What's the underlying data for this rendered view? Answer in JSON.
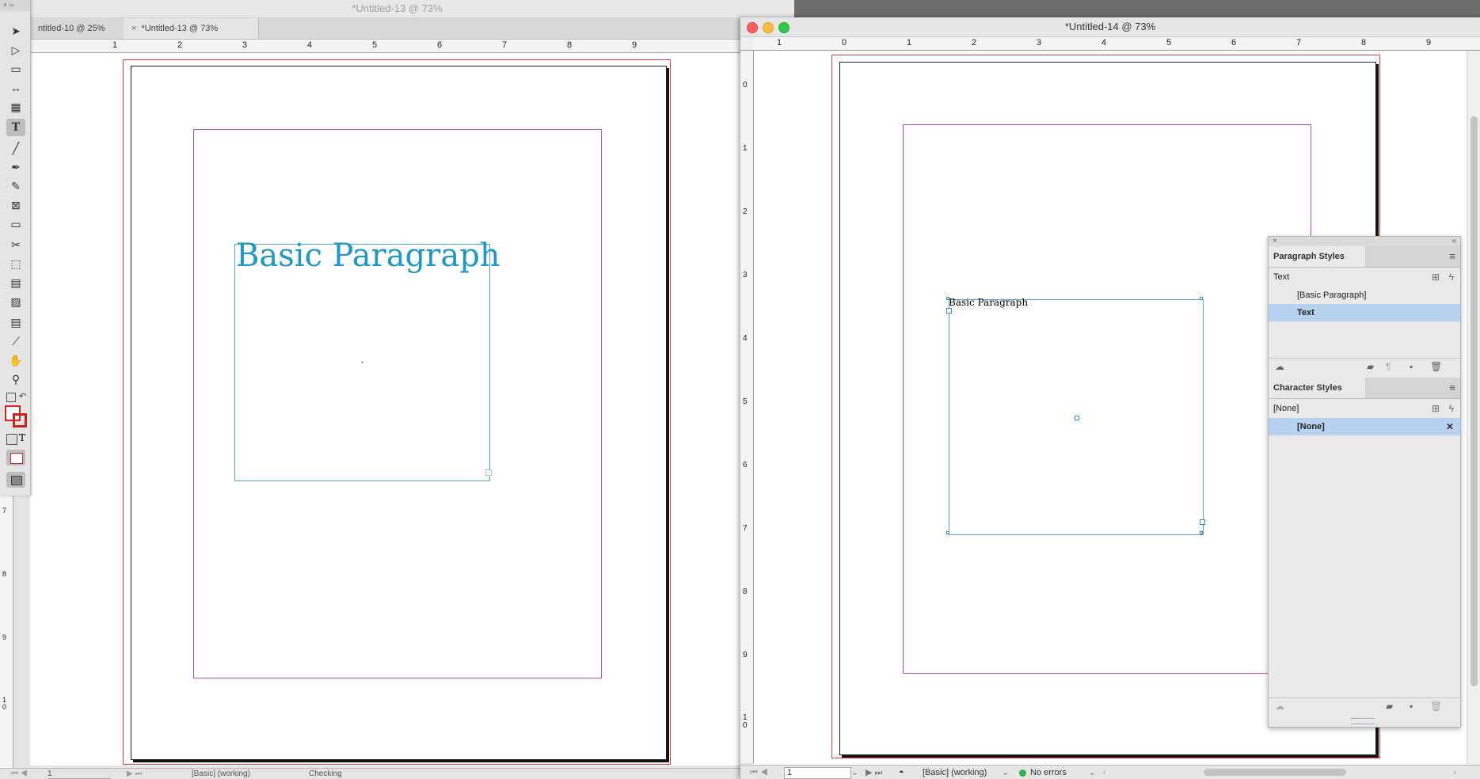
{
  "left_window": {
    "title": "*Untitled-13 @ 73%",
    "tabs": [
      "ntitled-10 @ 25%",
      "*Untitled-13 @ 73%"
    ],
    "tab_close_glyph": "×",
    "ruler_labels": [
      "1",
      "2",
      "3",
      "4",
      "5",
      "6",
      "7",
      "8",
      "9"
    ],
    "vruler_labels": [
      "7",
      "8",
      "9",
      "1\n0"
    ],
    "frame_text": "Basic Paragraph",
    "frame_text_color": "#1e98c8",
    "status": {
      "page": "1",
      "profile": "[Basic] (working)",
      "preflight": "Checking"
    }
  },
  "toolbar": {
    "collapse_glyphs": "×  ››",
    "tools": [
      {
        "name": "selection-tool",
        "glyph": "➤"
      },
      {
        "name": "direct-selection-tool",
        "glyph": "▷"
      },
      {
        "name": "page-tool",
        "glyph": "▭"
      },
      {
        "name": "gap-tool",
        "glyph": "↔"
      },
      {
        "name": "content-collector-tool",
        "glyph": "▦"
      },
      {
        "name": "type-tool",
        "glyph": "T"
      },
      {
        "name": "line-tool",
        "glyph": "╱"
      },
      {
        "name": "pen-tool",
        "glyph": "✒"
      },
      {
        "name": "pencil-tool",
        "glyph": "✎"
      },
      {
        "name": "rectangle-frame-tool",
        "glyph": "⊠"
      },
      {
        "name": "rectangle-tool",
        "glyph": "▭"
      },
      {
        "name": "scissors-tool",
        "glyph": "✂"
      },
      {
        "name": "free-transform-tool",
        "glyph": "⬚"
      },
      {
        "name": "gradient-swatch-tool",
        "glyph": "▤"
      },
      {
        "name": "gradient-feather-tool",
        "glyph": "▨"
      },
      {
        "name": "note-tool",
        "glyph": "▤"
      },
      {
        "name": "eyedropper-tool",
        "glyph": "⟋"
      },
      {
        "name": "hand-tool",
        "glyph": "✋"
      },
      {
        "name": "zoom-tool",
        "glyph": "⚲"
      }
    ]
  },
  "right_window": {
    "title": "*Untitled-14 @ 73%",
    "hruler_labels": [
      "1",
      "0",
      "1",
      "2",
      "3",
      "4",
      "5",
      "6",
      "7",
      "8",
      "9"
    ],
    "vruler_labels": [
      "0",
      "1",
      "2",
      "3",
      "4",
      "5",
      "6",
      "7",
      "8",
      "9",
      "1\n0"
    ],
    "frame_text": "Basic Paragraph",
    "status": {
      "page": "1",
      "profile": "[Basic] (working)",
      "preflight": "No errors",
      "preflight_color": "#2fb344"
    }
  },
  "paragraph_styles": {
    "title": "Paragraph Styles",
    "current": "Text",
    "items": [
      "[Basic Paragraph]",
      "Text"
    ],
    "selected_index": 1
  },
  "character_styles": {
    "title": "Character Styles",
    "current": "[None]",
    "items": [
      "[None]"
    ],
    "selected_index": 0
  }
}
